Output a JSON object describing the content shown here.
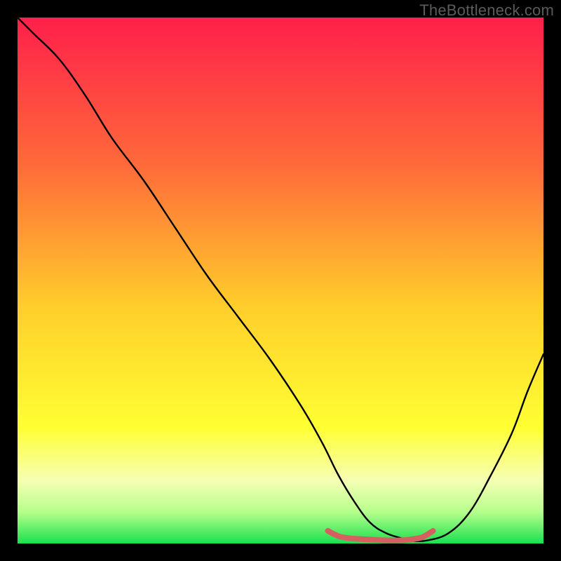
{
  "chart_data": {
    "type": "line",
    "watermark": "TheBottleneck.com",
    "xlim": [
      0,
      100
    ],
    "ylim": [
      0,
      100
    ],
    "gradient_stops": [
      {
        "offset": 0,
        "color": "#ff1f4b"
      },
      {
        "offset": 0.28,
        "color": "#ff6a3a"
      },
      {
        "offset": 0.55,
        "color": "#ffce2b"
      },
      {
        "offset": 0.78,
        "color": "#ffff33"
      },
      {
        "offset": 0.88,
        "color": "#f6ffb4"
      },
      {
        "offset": 0.94,
        "color": "#b6ff8c"
      },
      {
        "offset": 1.0,
        "color": "#1be04e"
      }
    ],
    "curve": {
      "x": [
        0,
        3,
        8,
        13,
        18,
        24,
        30,
        36,
        42,
        48,
        54,
        58,
        61,
        64,
        67,
        70,
        73,
        75,
        78,
        82,
        86,
        90,
        94,
        97,
        100
      ],
      "y": [
        100,
        97,
        92,
        85,
        77,
        69,
        60,
        51,
        43,
        35,
        26,
        19,
        13,
        8,
        4,
        2,
        1,
        0.5,
        0.6,
        2,
        6,
        13,
        21,
        29,
        36
      ]
    },
    "flat_segment": {
      "color": "#d66060",
      "width": 8,
      "points_x": [
        59,
        61,
        63,
        66,
        70,
        73,
        75,
        77,
        79
      ],
      "points_y": [
        2.4,
        1.4,
        1.0,
        0.8,
        0.6,
        0.6,
        0.8,
        1.2,
        2.4
      ]
    }
  }
}
